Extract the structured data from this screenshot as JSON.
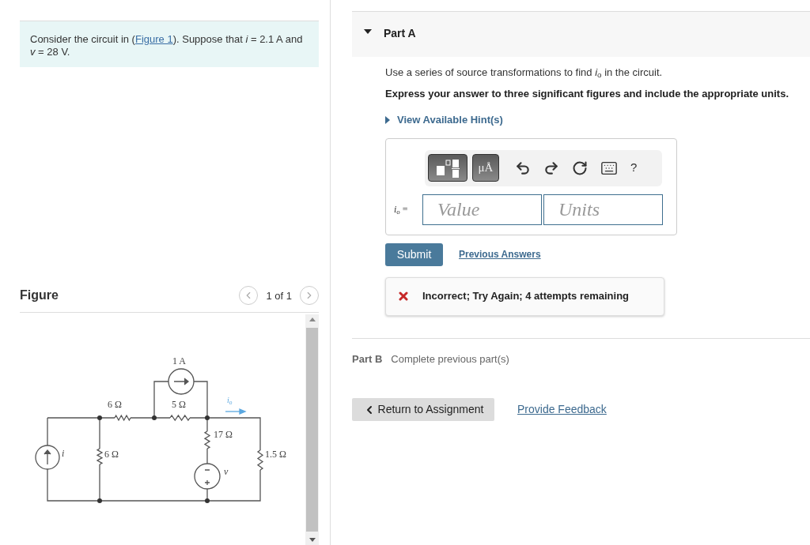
{
  "problem": {
    "prefix": "Consider the circuit in (",
    "link": "Figure 1",
    "suffix": "). Suppose that *i* = 2.1 A and *v* = 28 V."
  },
  "figure": {
    "title": "Figure",
    "pager": "1 of 1",
    "labels": [
      {
        "text": "1 A",
        "kind": "source"
      },
      {
        "text": "6 Ω",
        "kind": "resistor"
      },
      {
        "text": "5 Ω",
        "kind": "resistor"
      },
      {
        "text": "*i*$_{o}$",
        "kind": "current"
      },
      {
        "text": "17 Ω",
        "kind": "resistor"
      },
      {
        "text": "*i*",
        "kind": "source"
      },
      {
        "text": "6 Ω",
        "kind": "resistor"
      },
      {
        "text": "1.5 Ω",
        "kind": "resistor"
      },
      {
        "text": "*v*",
        "kind": "source"
      }
    ]
  },
  "part_a": {
    "title": "Part A",
    "expanded": true,
    "instruction": "Use a series of source transformations to find *i*$_{o}$ in the circuit.",
    "emphasis": "Express your answer to three significant figures and include the appropriate units.",
    "hint_link": "View Available Hint(s)",
    "units_button": "μÅ",
    "help_button": "?",
    "variable": "*i*$_{o}$ =",
    "value_placeholder": "Value",
    "units_placeholder": "Units",
    "submit": "Submit",
    "previous_link": "Previous Answers",
    "feedback": {
      "kind": "incorrect",
      "text": "Incorrect; Try Again; 4 attempts remaining"
    }
  },
  "part_b": {
    "title": "Part B",
    "status": "Complete previous part(s)"
  },
  "footer": {
    "return_button": "Return to Assignment",
    "feedback_link": "Provide Feedback"
  }
}
